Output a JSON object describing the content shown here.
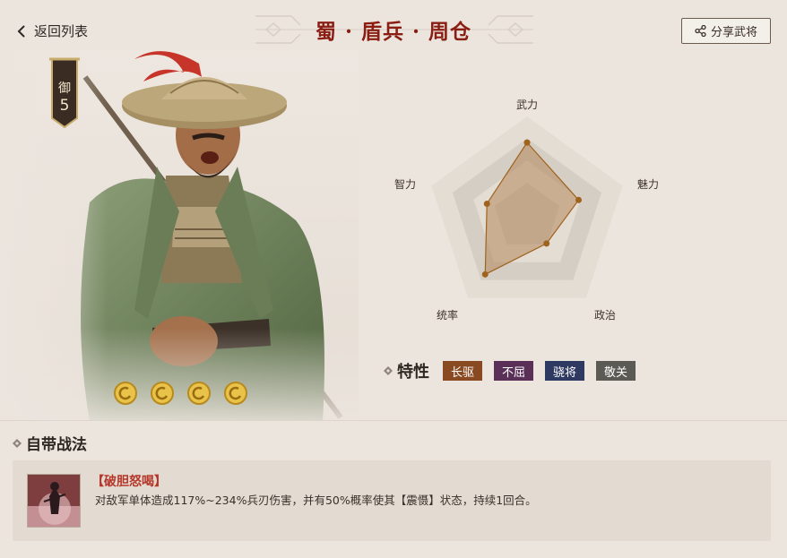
{
  "header": {
    "back_label": "返回列表",
    "title": "蜀 · 盾兵 · 周仓",
    "share_label": "分享武将"
  },
  "general": {
    "rank_glyph": "御",
    "rank_number": "5",
    "star_count": 4
  },
  "radar": {
    "axes": [
      "武力",
      "魅力",
      "政治",
      "统率",
      "智力"
    ],
    "values": [
      0.74,
      0.54,
      0.33,
      0.71,
      0.42
    ]
  },
  "traits": {
    "heading": "特性",
    "items": [
      {
        "label": "长驱",
        "color": "#8a4a21"
      },
      {
        "label": "不屈",
        "color": "#5a3058"
      },
      {
        "label": "骁将",
        "color": "#2e3a62"
      },
      {
        "label": "敬关",
        "color": "#5c5a55"
      }
    ]
  },
  "skills": {
    "heading": "自带战法",
    "items": [
      {
        "name": "【破胆怒喝】",
        "description": "对敌军单体造成117%~234%兵刃伤害，并有50%概率使其【震慑】状态，持续1回合。"
      }
    ]
  },
  "colors": {
    "title_red": "#8a1e13",
    "radar_fill": "#b5875c",
    "radar_point": "#a0631d"
  }
}
